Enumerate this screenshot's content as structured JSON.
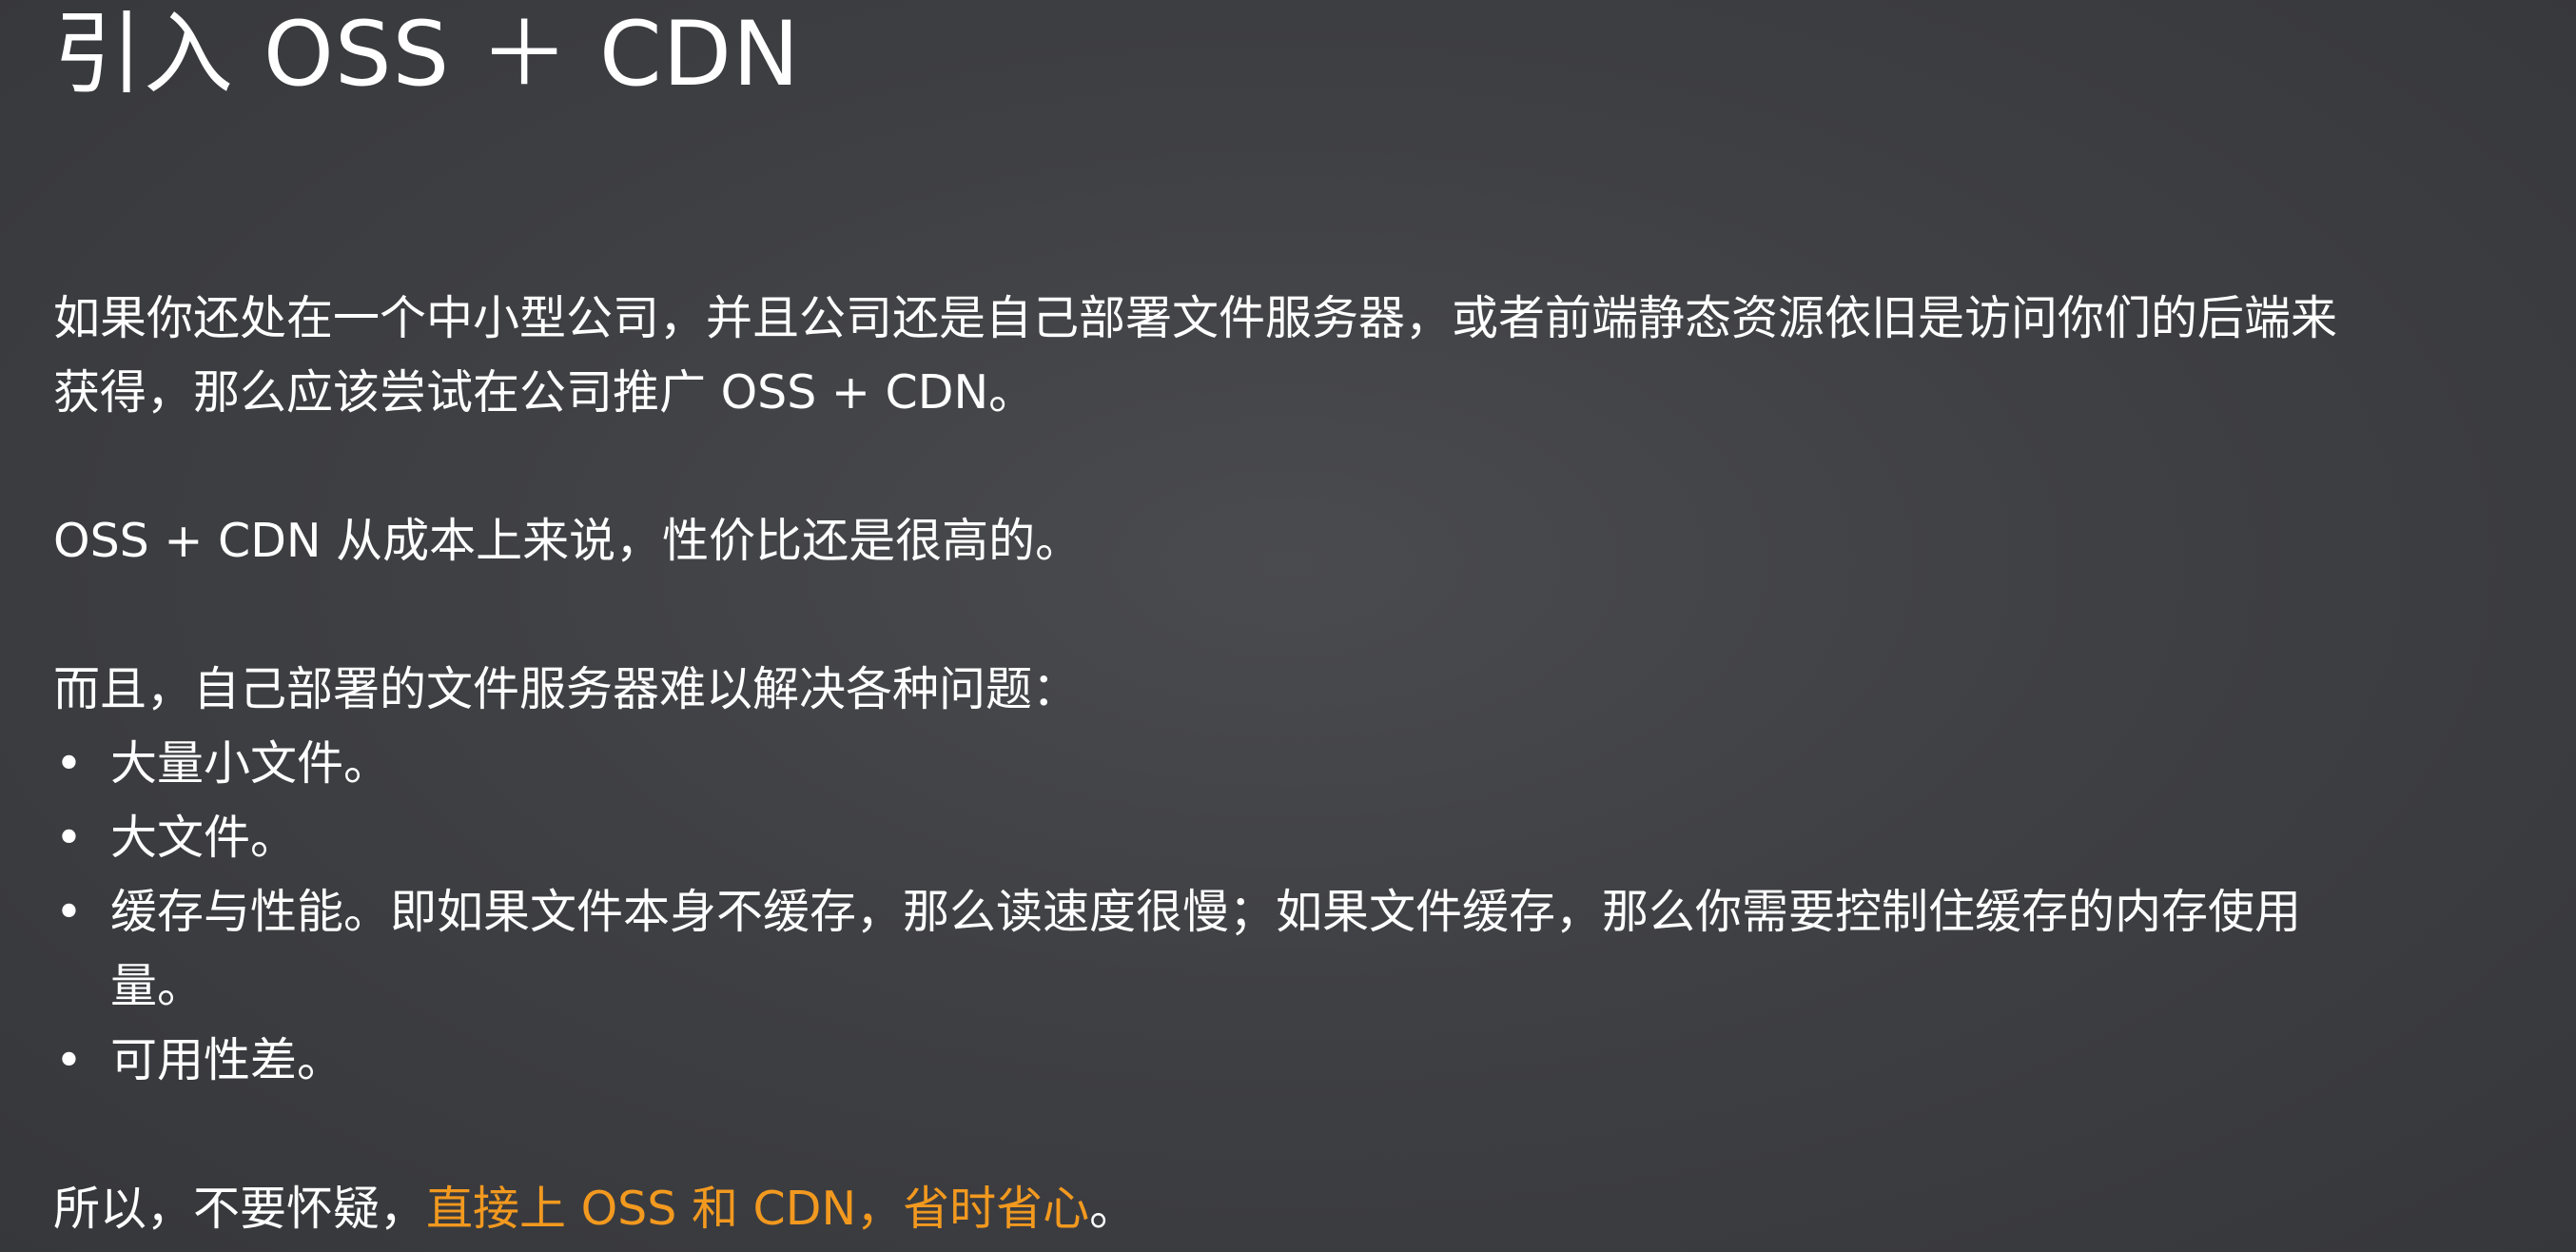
{
  "slide": {
    "title": "引入 OSS ＋ CDN",
    "para1_line1": "如果你还处在一个中小型公司，并且公司还是自己部署文件服务器，或者前端静态资源依旧是访问你们的后端来",
    "para1_line2": "获得，那么应该尝试在公司推广 OSS + CDN。",
    "para2": "OSS +  CDN 从成本上来说，性价比还是很高的。",
    "para3": "而且，自己部署的文件服务器难以解决各种问题：",
    "bullet_symbol": "•",
    "bullets": [
      {
        "line1": "大量小文件。"
      },
      {
        "line1": "大文件。"
      },
      {
        "line1": "缓存与性能。即如果文件本身不缓存，那么读速度很慢；如果文件缓存，那么你需要控制住缓存的内存使用",
        "line2": "量。"
      },
      {
        "line1": "可用性差。"
      }
    ],
    "conclusion_prefix": "所以，不要怀疑，",
    "conclusion_highlight": "直接上 OSS 和 CDN，省时省心",
    "conclusion_suffix": "。",
    "highlight_color": "#f2991f"
  }
}
